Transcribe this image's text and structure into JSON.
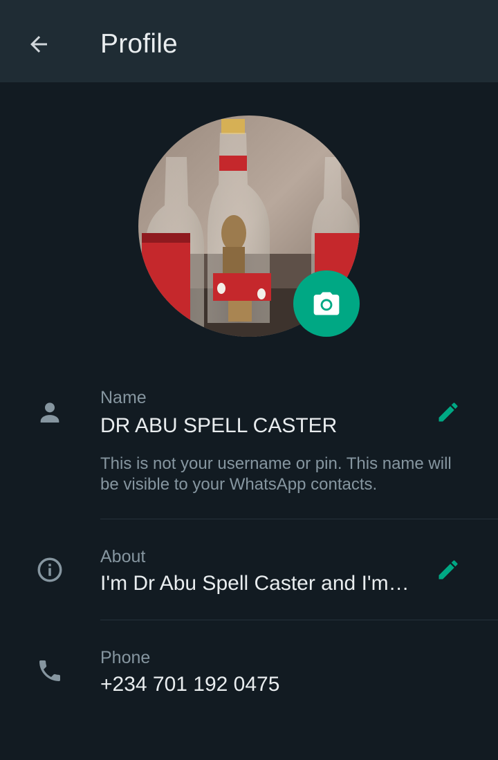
{
  "header": {
    "title": "Profile",
    "back_icon": "arrow-left-icon"
  },
  "avatar": {
    "description_icon": "profile-photo",
    "camera_icon": "camera-icon"
  },
  "fields": {
    "name": {
      "label": "Name",
      "value": "DR ABU SPELL CASTER",
      "note": "This is not your username or pin. This name will be visible to your WhatsApp contacts.",
      "icon": "person-icon",
      "edit_icon": "pencil-icon"
    },
    "about": {
      "label": "About",
      "value": "I'm Dr Abu Spell Caster and I'm…",
      "icon": "info-icon",
      "edit_icon": "pencil-icon"
    },
    "phone": {
      "label": "Phone",
      "value": "+234 701 192 0475",
      "icon": "phone-icon"
    }
  },
  "colors": {
    "background": "#121b22",
    "header": "#1f2c34",
    "accent": "#00a884",
    "primary_text": "#e9edef",
    "secondary_text": "#8696a0"
  }
}
